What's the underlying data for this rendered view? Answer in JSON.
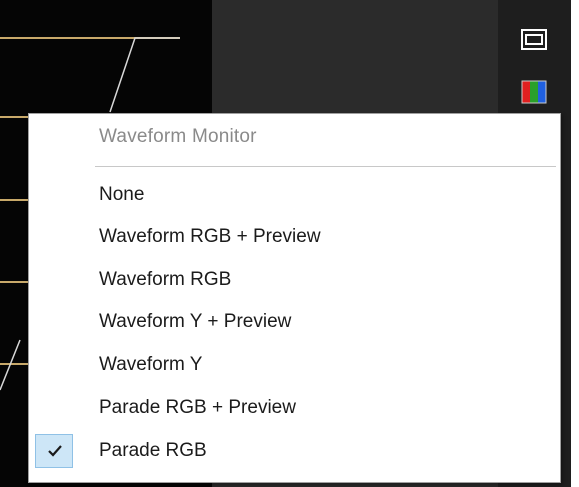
{
  "menu": {
    "header": "Waveform Monitor",
    "items": [
      {
        "label": "None",
        "checked": false
      },
      {
        "label": "Waveform RGB + Preview",
        "checked": false
      },
      {
        "label": "Waveform RGB",
        "checked": false
      },
      {
        "label": "Waveform Y + Preview",
        "checked": false
      },
      {
        "label": "Waveform Y",
        "checked": false
      },
      {
        "label": "Parade RGB + Preview",
        "checked": false
      },
      {
        "label": "Parade RGB",
        "checked": true
      }
    ]
  },
  "toolbar": {
    "icons": [
      "monitor-icon",
      "rgb-parade-icon"
    ]
  },
  "colors": {
    "background_app": "#2b2b2b",
    "waveform_pane": "#050505",
    "menu_background": "#ffffff",
    "menu_header_text": "#8a8a8a",
    "menu_text": "#1b1b1b",
    "check_highlight": "#cde6f7",
    "waveform_lines": "#c8a96a"
  }
}
